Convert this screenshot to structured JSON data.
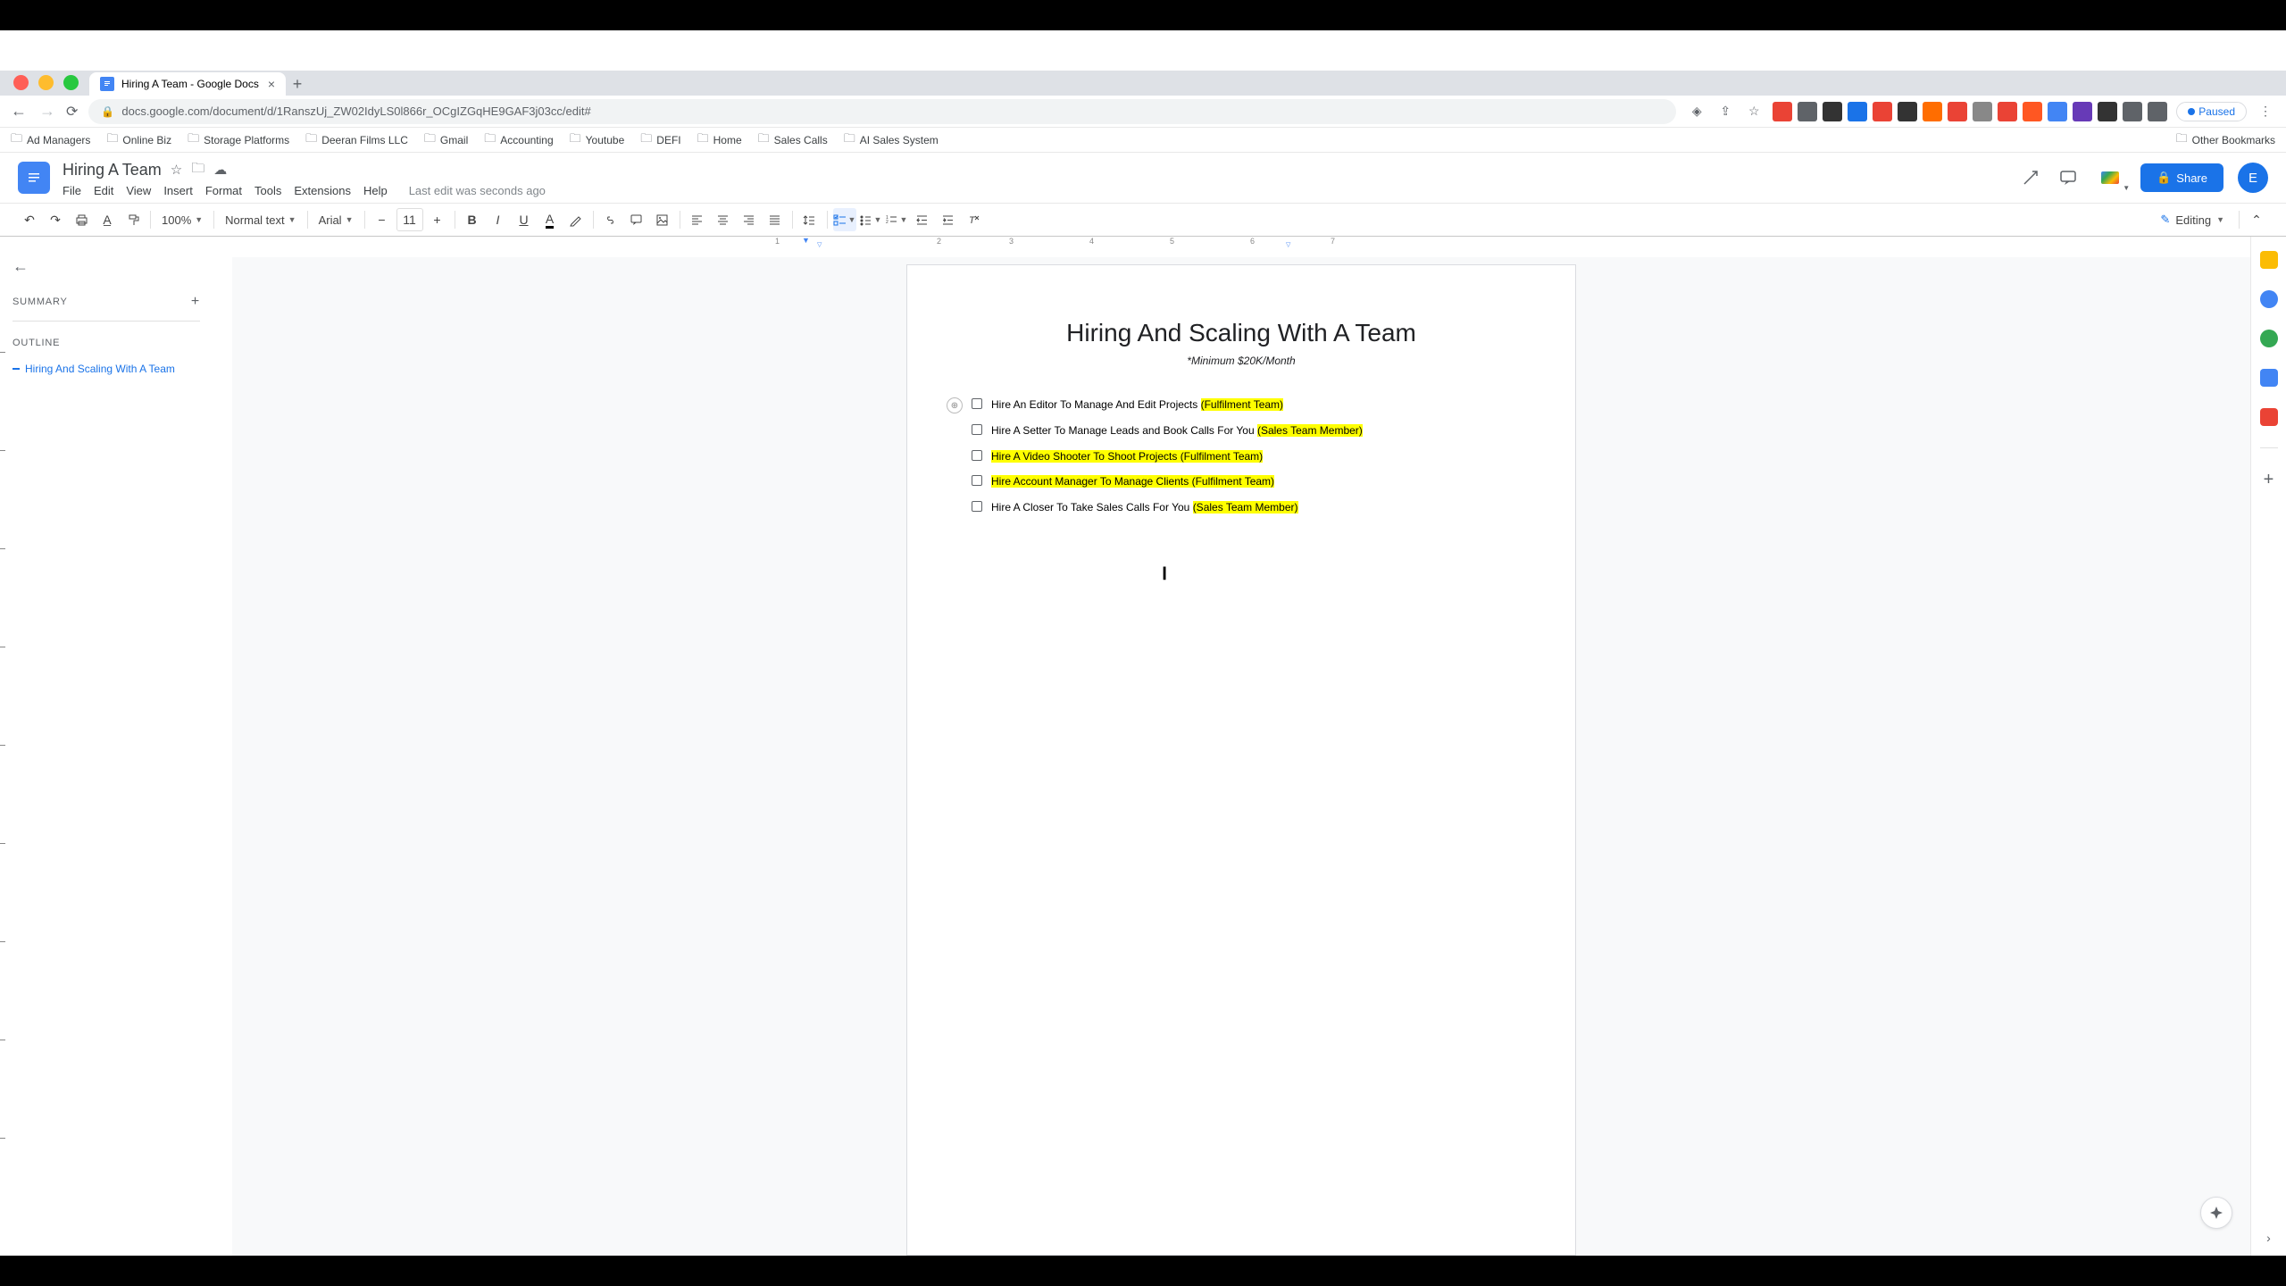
{
  "browser": {
    "tab_title": "Hiring A Team - Google Docs",
    "url": "docs.google.com/document/d/1RanszUj_ZW02IdyLS0l866r_OCgIZGqHE9GAF3j03cc/edit#",
    "paused_label": "Paused",
    "new_tab_tooltip": "+"
  },
  "bookmarks": [
    "Ad Managers",
    "Online Biz",
    "Storage Platforms",
    "Deeran Films LLC",
    "Gmail",
    "Accounting",
    "Youtube",
    "DEFI",
    "Home",
    "Sales Calls",
    "AI Sales System"
  ],
  "other_bookmarks_label": "Other Bookmarks",
  "docs": {
    "title": "Hiring A Team",
    "menus": [
      "File",
      "Edit",
      "View",
      "Insert",
      "Format",
      "Tools",
      "Extensions",
      "Help"
    ],
    "last_edit": "Last edit was seconds ago",
    "share_label": "Share",
    "avatar_letter": "E",
    "editing_label": "Editing"
  },
  "toolbar": {
    "zoom": "100%",
    "style": "Normal text",
    "font": "Arial",
    "size": "11"
  },
  "outline": {
    "summary_label": "SUMMARY",
    "outline_label": "OUTLINE",
    "heading": "Hiring And Scaling With A Team"
  },
  "document": {
    "heading": "Hiring And Scaling With A Team",
    "subtitle": "*Minimum $20K/Month",
    "items": [
      {
        "text": "Hire An Editor To Manage And Edit Projects ",
        "hl": "(Fulfilment Team)",
        "highlight_full": false,
        "badge": true
      },
      {
        "text": "Hire A Setter To Manage Leads and Book Calls For You ",
        "hl": "(Sales Team Member)",
        "highlight_full": false,
        "badge": false
      },
      {
        "text": "Hire A Video Shooter To Shoot Projects (Fulfilment Team)",
        "hl": "",
        "highlight_full": true,
        "badge": false
      },
      {
        "text": "Hire Account Manager To Manage Clients (Fulfilment Team)",
        "hl": "",
        "highlight_full": true,
        "badge": false
      },
      {
        "text": "Hire A Closer To Take Sales Calls For You ",
        "hl": "(Sales Team Member)",
        "highlight_full": false,
        "badge": false
      }
    ]
  },
  "extensions_colors": [
    "#ea4335",
    "#5f6368",
    "#333",
    "#1a73e8",
    "#ea4335",
    "#333",
    "#ff6d00",
    "#ea4335",
    "#888",
    "#ea4335",
    "#ff5722",
    "#4285f4",
    "#673ab7",
    "#333",
    "#5f6368",
    "#5f6368"
  ]
}
